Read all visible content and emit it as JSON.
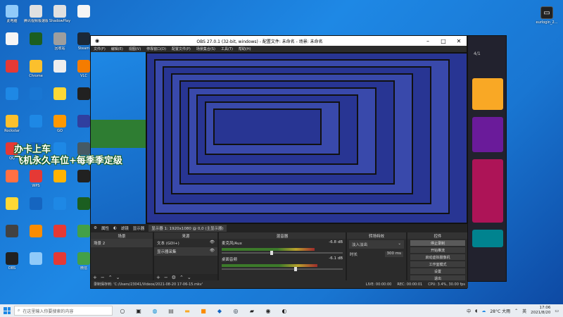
{
  "desktop": {
    "icons": [
      {
        "name": "此电脑",
        "color": "#90caf9"
      },
      {
        "name": "腾讯视频极速版",
        "color": "#e0e0e0"
      },
      {
        "name": "ShadowPlay",
        "color": "#e0e0e0"
      },
      {
        "name": "",
        "color": "#f5f5f5"
      },
      {
        "name": "",
        "color": "#f5f5f5"
      },
      {
        "name": "",
        "color": "#1b5e20"
      },
      {
        "name": "回收站",
        "color": "#9e9e9e"
      },
      {
        "name": "Steam",
        "color": "#1b2838"
      },
      {
        "name": "",
        "color": "#e53935"
      },
      {
        "name": "Chrome",
        "color": "#fbc02d"
      },
      {
        "name": "",
        "color": "#eeeeee"
      },
      {
        "name": "VLC",
        "color": "#f57c00"
      },
      {
        "name": "",
        "color": "#1e88e5"
      },
      {
        "name": "",
        "color": "#1976d2"
      },
      {
        "name": "",
        "color": "#fdd835"
      },
      {
        "name": "",
        "color": "#212121"
      },
      {
        "name": "Rockstar",
        "color": "#fbc02d"
      },
      {
        "name": "",
        "color": "#1e88e5"
      },
      {
        "name": "GO",
        "color": "#ff9800"
      },
      {
        "name": "",
        "color": "#303f9f"
      },
      {
        "name": "QQ",
        "color": "#e53935"
      },
      {
        "name": "",
        "color": "#1565c0"
      },
      {
        "name": "",
        "color": "#1e88e5"
      },
      {
        "name": "",
        "color": "#455a64"
      },
      {
        "name": "",
        "color": "#ff7043"
      },
      {
        "name": "WPS",
        "color": "#e53935"
      },
      {
        "name": "",
        "color": "#ffb300"
      },
      {
        "name": "",
        "color": "#212121"
      },
      {
        "name": "",
        "color": "#fdd835"
      },
      {
        "name": "",
        "color": "#1565c0"
      },
      {
        "name": "",
        "color": "#1e88e5"
      },
      {
        "name": "",
        "color": "#1b5e20"
      },
      {
        "name": "",
        "color": "#424242"
      },
      {
        "name": "",
        "color": "#fb8c00"
      },
      {
        "name": "",
        "color": "#e53935"
      },
      {
        "name": "",
        "color": "#43a047"
      },
      {
        "name": "OBS",
        "color": "#212121"
      },
      {
        "name": "",
        "color": "#90caf9"
      },
      {
        "name": "",
        "color": "#e53935"
      },
      {
        "name": "微信",
        "color": "#43a047"
      }
    ],
    "top_right_icon": {
      "name": "eurlogin_2...",
      "color": "#212121"
    },
    "overlay_text": [
      "办卡上车",
      "飞机永久车位+每季季定级"
    ]
  },
  "obs": {
    "title": "OBS 27.0.1 (32-bit, windows) - 配置文件: 未命名 - 场景: 未命名",
    "menu": [
      "文件(F)",
      "编辑(E)",
      "视图(V)",
      "停靠窗口(D)",
      "配置文件(P)",
      "场景集合(S)",
      "工具(T)",
      "帮助(H)"
    ],
    "scenebar": {
      "properties": "属性",
      "filters": "滤镜",
      "source_label": "显示器",
      "source_value": "显示器 1: 1920x1080 @ 0,0 (主显示器)"
    },
    "scenes": {
      "header": "场景",
      "items": [
        "场景 2"
      ]
    },
    "sources": {
      "header": "来源",
      "items": [
        {
          "label": "文本 (GDI+)",
          "selected": false
        },
        {
          "label": "显示器采集",
          "selected": true
        }
      ]
    },
    "mixer": {
      "header": "混音器",
      "channels": [
        {
          "name": "麦克风/Aux",
          "db": "-6.8 dB",
          "level": 0.78,
          "volume": 0.4
        },
        {
          "name": "桌面音频",
          "db": "-6.1 dB",
          "level": 0.8,
          "volume": 0.6
        }
      ]
    },
    "transitions": {
      "header": "转场特效",
      "type": "淡入淡出",
      "duration_label": "时长",
      "duration": "300 ms"
    },
    "controls": {
      "header": "控件",
      "buttons": [
        "停止录制",
        "开始推流",
        "启动虚拟摄像机",
        "工作室模式",
        "设置",
        "退出"
      ]
    },
    "status": {
      "path": "录制保存到: 'C:/Users/23041/Videos/2021-08-20 17-06-15.mkv'",
      "live": "LIVE: 00:00:00",
      "rec": "REC: 00:00:01",
      "cpu": "CPU: 3.4%, 30.00 fps"
    }
  },
  "phone": {
    "page": "4/1"
  },
  "taskbar": {
    "search_placeholder": "在这里输入你要搜索的内容",
    "weather": "28°C 大雨",
    "ime": "中",
    "lang": "英",
    "time": "17:06",
    "date": "2021/8/20"
  }
}
